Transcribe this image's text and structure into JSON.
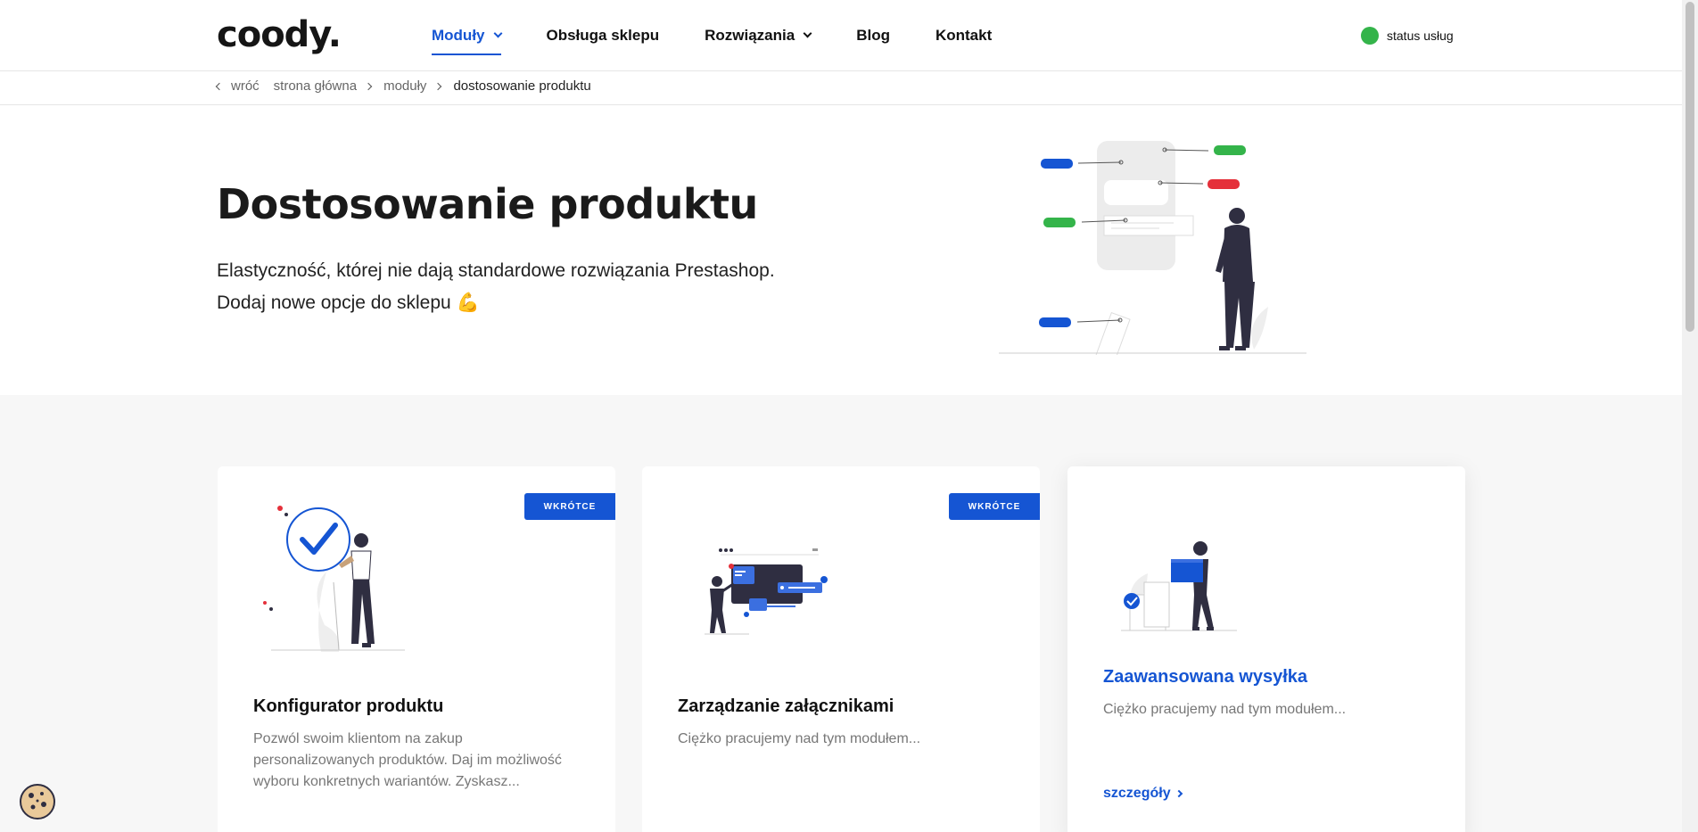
{
  "header": {
    "logo": "coody.",
    "nav": [
      {
        "label": "Moduły",
        "dropdown": true,
        "active": true
      },
      {
        "label": "Obsługa sklepu",
        "dropdown": false,
        "active": false
      },
      {
        "label": "Rozwiązania",
        "dropdown": true,
        "active": false
      },
      {
        "label": "Blog",
        "dropdown": false,
        "active": false
      },
      {
        "label": "Kontakt",
        "dropdown": false,
        "active": false
      }
    ],
    "status_label": "status usług",
    "status_color": "#34b44a"
  },
  "breadcrumb": {
    "back": "wróć",
    "items": [
      "strona główna",
      "moduły"
    ],
    "current": "dostosowanie produktu"
  },
  "hero": {
    "title": "Dostosowanie produktu",
    "subtitle_line1": "Elastyczność, której nie dają standardowe rozwiązania Prestashop.",
    "subtitle_line2": "Dodaj nowe opcje do sklepu 💪"
  },
  "cards": [
    {
      "badge": "WKRÓTCE",
      "title": "Konfigurator produktu",
      "description": "Pozwól swoim klientom na zakup personalizowanych produktów. Daj im możliwość wyboru konkretnych wariantów. Zyskasz..."
    },
    {
      "badge": "WKRÓTCE",
      "title": "Zarządzanie załącznikami",
      "description": "Ciężko pracujemy nad tym modułem..."
    },
    {
      "title": "Zaawansowana wysyłka",
      "description": "Ciężko pracujemy nad tym modułem...",
      "more": "szczegóły"
    }
  ],
  "colors": {
    "accent": "#1555d3",
    "green": "#34b44a",
    "red": "#e5303a"
  }
}
